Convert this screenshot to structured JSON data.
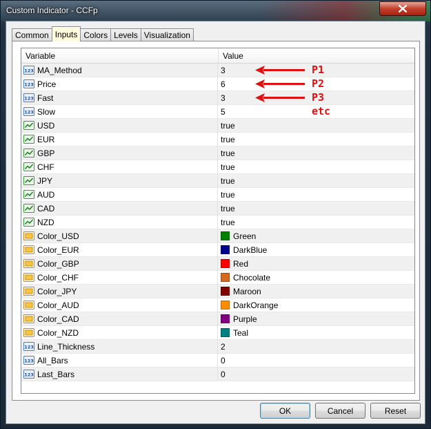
{
  "window": {
    "title": "Custom Indicator - CCFp"
  },
  "tabs": [
    {
      "label": "Common",
      "active": false
    },
    {
      "label": "Inputs",
      "active": true
    },
    {
      "label": "Colors",
      "active": false
    },
    {
      "label": "Levels",
      "active": false
    },
    {
      "label": "Visualization",
      "active": false
    }
  ],
  "table": {
    "headers": {
      "variable": "Variable",
      "value": "Value"
    },
    "rows": [
      {
        "name": "MA_Method",
        "value": "3",
        "type": "int-icon"
      },
      {
        "name": "Price",
        "value": "6",
        "type": "int-icon"
      },
      {
        "name": "Fast",
        "value": "3",
        "type": "int-icon"
      },
      {
        "name": "Slow",
        "value": "5",
        "type": "int-icon"
      },
      {
        "name": "USD",
        "value": "true",
        "type": "bool-icon"
      },
      {
        "name": "EUR",
        "value": "true",
        "type": "bool-icon"
      },
      {
        "name": "GBP",
        "value": "true",
        "type": "bool-icon"
      },
      {
        "name": "CHF",
        "value": "true",
        "type": "bool-icon"
      },
      {
        "name": "JPY",
        "value": "true",
        "type": "bool-icon"
      },
      {
        "name": "AUD",
        "value": "true",
        "type": "bool-icon"
      },
      {
        "name": "CAD",
        "value": "true",
        "type": "bool-icon"
      },
      {
        "name": "NZD",
        "value": "true",
        "type": "bool-icon"
      },
      {
        "name": "Color_USD",
        "value": "Green",
        "type": "color-icon",
        "color": "#008000"
      },
      {
        "name": "Color_EUR",
        "value": "DarkBlue",
        "type": "color-icon",
        "color": "#00008b"
      },
      {
        "name": "Color_GBP",
        "value": "Red",
        "type": "color-icon",
        "color": "#ff0000"
      },
      {
        "name": "Color_CHF",
        "value": "Chocolate",
        "type": "color-icon",
        "color": "#d2691e"
      },
      {
        "name": "Color_JPY",
        "value": "Maroon",
        "type": "color-icon",
        "color": "#800000"
      },
      {
        "name": "Color_AUD",
        "value": "DarkOrange",
        "type": "color-icon",
        "color": "#ff8c00"
      },
      {
        "name": "Color_CAD",
        "value": "Purple",
        "type": "color-icon",
        "color": "#800080"
      },
      {
        "name": "Color_NZD",
        "value": "Teal",
        "type": "color-icon",
        "color": "#008080"
      },
      {
        "name": "Line_Thickness",
        "value": "2",
        "type": "int-icon"
      },
      {
        "name": "All_Bars",
        "value": "0",
        "type": "int-icon"
      },
      {
        "name": "Last_Bars",
        "value": "0",
        "type": "int-icon"
      }
    ]
  },
  "annotations": [
    {
      "label": "P1",
      "arrow": true
    },
    {
      "label": "P2",
      "arrow": true
    },
    {
      "label": "P3",
      "arrow": true
    },
    {
      "label": "etc",
      "arrow": false
    }
  ],
  "annotation_color": "#e01010",
  "buttons": {
    "ok": "OK",
    "cancel": "Cancel",
    "reset": "Reset"
  }
}
